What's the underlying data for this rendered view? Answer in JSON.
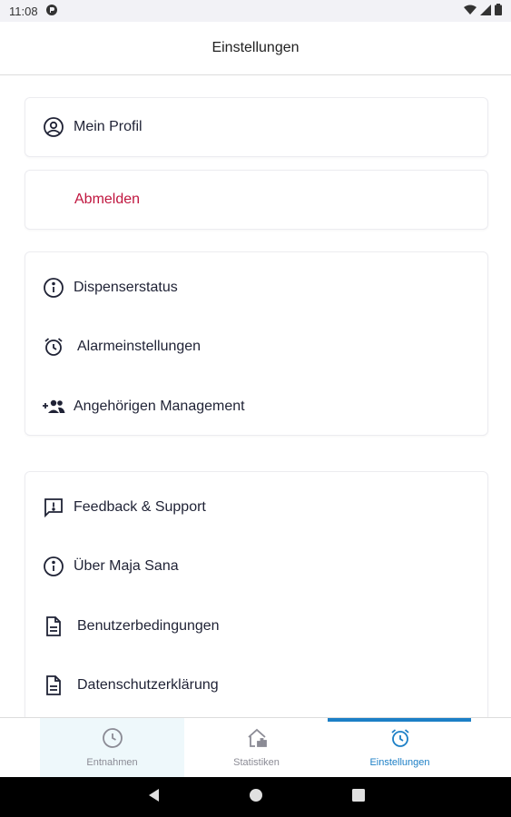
{
  "status_bar": {
    "time": "11:08"
  },
  "app_bar": {
    "title": "Einstellungen"
  },
  "profile_card": {
    "label": "Mein Profil",
    "icon": "account-circle-icon"
  },
  "logout_card": {
    "label": "Abmelden",
    "color": "#c0163f"
  },
  "device_card": {
    "items": [
      {
        "label": "Dispenserstatus",
        "icon": "info-icon"
      },
      {
        "label": "Alarmeinstellungen",
        "icon": "alarm-clock-icon"
      },
      {
        "label": "Angehörigen Management",
        "icon": "group-add-icon"
      }
    ]
  },
  "info_card": {
    "items": [
      {
        "label": "Feedback & Support",
        "icon": "feedback-icon"
      },
      {
        "label": "Über Maja Sana",
        "icon": "info-icon"
      },
      {
        "label": "Benutzerbedingungen",
        "icon": "document-icon"
      },
      {
        "label": "Datenschutzerklärung",
        "icon": "document-icon"
      }
    ]
  },
  "bottom_nav": {
    "tabs": [
      {
        "label": "Entnahmen",
        "icon": "clock-icon"
      },
      {
        "label": "Statistiken",
        "icon": "home-chart-icon"
      },
      {
        "label": "Einstellungen",
        "icon": "alarm-clock-icon",
        "active": true
      }
    ],
    "accent": "#1c7fc6"
  }
}
